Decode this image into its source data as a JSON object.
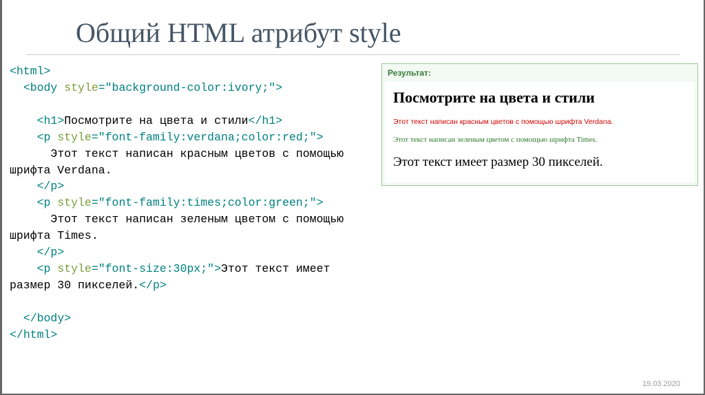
{
  "title": "Общий HTML атрибут style",
  "code": {
    "l1_open": "<",
    "l1_tag": "html",
    "l1_close": ">",
    "l2_pre": "  <",
    "l2_tag": "body",
    "l2_sp": " ",
    "l2_attr": "style",
    "l2_eq": "=",
    "l2_val": "\"background-color:ivory;\"",
    "l2_close": ">",
    "l3_pre": "    <",
    "l3_tag": "h1",
    "l3_mid": ">",
    "l3_txt": "Посмотрите на цвета и стили",
    "l3_ctag": "</",
    "l3_ctagn": "h1",
    "l3_cclose": ">",
    "l4_pre": "    <",
    "l4_tag": "p",
    "l4_sp": " ",
    "l4_attr": "style",
    "l4_eq": "=",
    "l4_val": "\"font-family:verdana;color:red;\"",
    "l4_close": ">",
    "l5_txt": "      Этот текст написан красным цветов с помощью шрифта Verdana.",
    "l6_pre": "    </",
    "l6_tag": "p",
    "l6_close": ">",
    "l7_pre": "    <",
    "l7_tag": "p",
    "l7_sp": " ",
    "l7_attr": "style",
    "l7_eq": "=",
    "l7_val": "\"font-family:times;color:green;\"",
    "l7_close": ">",
    "l8_txt": "      Этот текст написан зеленым цветом с помощью шрифта Times.",
    "l9_pre": "    </",
    "l9_tag": "p",
    "l9_close": ">",
    "l10_pre": "    <",
    "l10_tag": "p",
    "l10_sp": " ",
    "l10_attr": "style",
    "l10_eq": "=",
    "l10_val": "\"font-size:30px;\"",
    "l10_mid": ">",
    "l10_txt": "Этот текст имеет размер 30 пикселей.",
    "l10_ctag": "</",
    "l10_ctagn": "p",
    "l10_cclose": ">",
    "l11_pre": "  </",
    "l11_tag": "body",
    "l11_close": ">",
    "l12_pre": "</",
    "l12_tag": "html",
    "l12_close": ">"
  },
  "result": {
    "label": "Результат:",
    "h1": "Посмотрите на цвета и стили",
    "p1": "Этот текст написан красным цветов с помощью шрифта Verdana.",
    "p2": "Этот текст написан зеленым цветом с помощью шрифта Times.",
    "p3": "Этот текст имеет размер 30 пикселей."
  },
  "footer_date": "19.03.2020"
}
